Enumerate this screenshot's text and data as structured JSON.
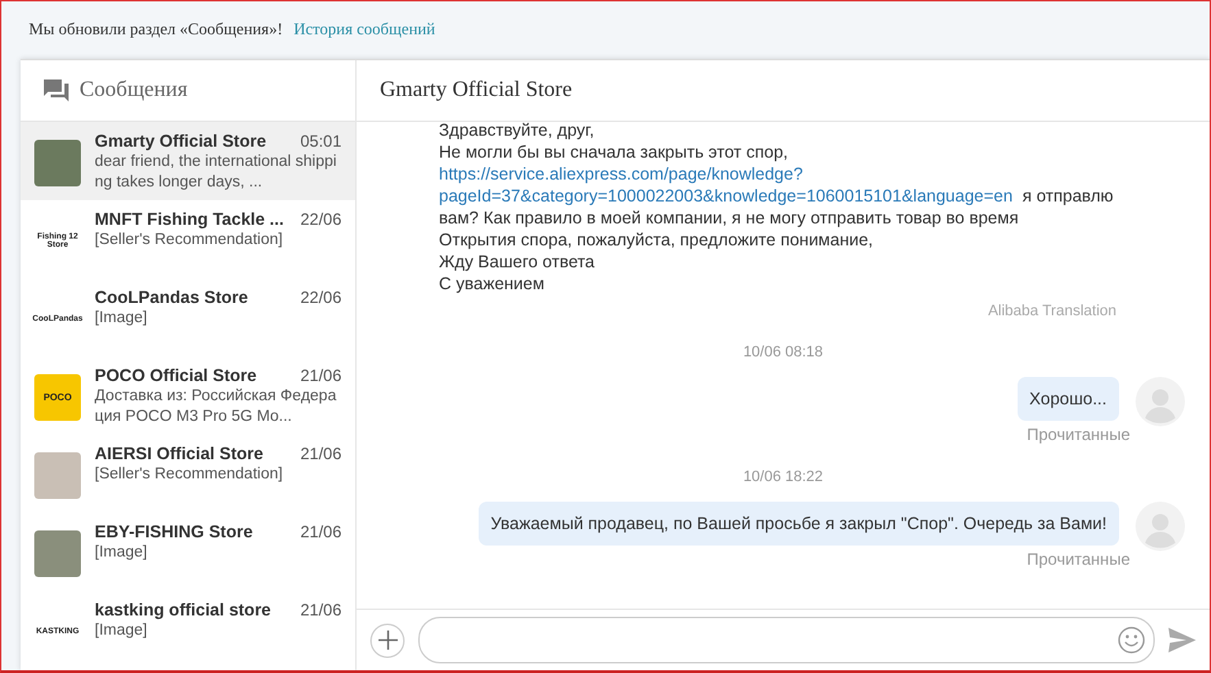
{
  "banner": {
    "text": "Мы обновили раздел «Сообщения»!",
    "link": "История сообщений"
  },
  "sidebar": {
    "title": "Сообщения",
    "conversations": [
      {
        "name": "Gmarty Official Store",
        "time": "05:01",
        "preview": "dear friend,  the international shipping takes longer days, ...",
        "selected": true,
        "avatar": {
          "kind": "photo",
          "color": "#6b7a5e"
        }
      },
      {
        "name": "MNFT Fishing Tackle ...",
        "time": "22/06",
        "preview": "[Seller's Recommendation]",
        "selected": false,
        "avatar": {
          "kind": "logo",
          "text": "Fishing 12 Store",
          "color": "#ffffff"
        }
      },
      {
        "name": "CooLPandas Store",
        "time": "22/06",
        "preview": "[Image]",
        "selected": false,
        "avatar": {
          "kind": "logo",
          "text": "CooLPandas",
          "color": "#ffffff"
        }
      },
      {
        "name": "POCO Official Store",
        "time": "21/06",
        "preview": "Доставка из: Российская Федерация POCO M3 Pro 5G Mo...",
        "selected": false,
        "avatar": {
          "kind": "logo",
          "text": "POCO",
          "color": "#f7c600"
        }
      },
      {
        "name": "AIERSI Official Store",
        "time": "21/06",
        "preview": "[Seller's Recommendation]",
        "selected": false,
        "avatar": {
          "kind": "photo",
          "color": "#c9bfb5"
        }
      },
      {
        "name": "EBY-FISHING Store",
        "time": "21/06",
        "preview": "[Image]",
        "selected": false,
        "avatar": {
          "kind": "photo",
          "color": "#8a8f7c"
        }
      },
      {
        "name": "kastking official store",
        "time": "21/06",
        "preview": "[Image]",
        "selected": false,
        "avatar": {
          "kind": "logo",
          "text": "KASTKING",
          "color": "#ffffff"
        }
      }
    ]
  },
  "chat": {
    "title": "Gmarty Official Store",
    "messages": [
      {
        "kind": "incoming",
        "before": "Здравствуйте, друг,\nНе могли бы вы сначала закрыть этот спор,",
        "link": "https://service.aliexpress.com/page/knowledge?pageId=37&category=1000022003&knowledge=1060015101&language=en",
        "after": " я отправлю вам? Как правило в моей компании, я не могу отправить товар во время\nОткрытия спора, пожалуйста, предложите понимание,\nЖду Вашего ответа\nС уважением",
        "note": "Alibaba Translation"
      },
      {
        "kind": "time",
        "text": "10/06 08:18"
      },
      {
        "kind": "outgoing",
        "text": "Хорошо...",
        "status": "Прочитанные"
      },
      {
        "kind": "time",
        "text": "10/06 18:22"
      },
      {
        "kind": "outgoing",
        "text": "Уважаемый продавец, по Вашей просьбе я закрыл \"Спор\". Очередь за Вами!",
        "status": "Прочитанные"
      }
    ]
  }
}
